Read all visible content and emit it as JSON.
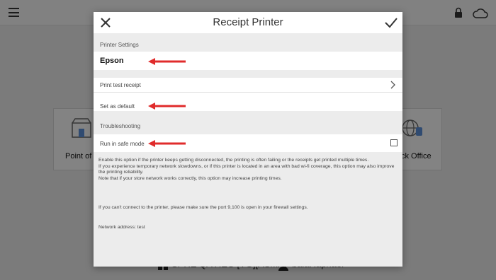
{
  "background": {
    "tiles": [
      {
        "label": "Point of S"
      },
      {
        "label": "ck Office"
      }
    ],
    "footer": {
      "store": "SPRE QA REG [YG][ASMA]",
      "user": "baiaRaphael"
    }
  },
  "dialog": {
    "title": "Receipt Printer",
    "close_icon": "close-icon",
    "confirm_icon": "checkmark-icon",
    "printer_settings": {
      "header": "Printer Settings",
      "printer_name": "Epson",
      "print_test_label": "Print test receipt",
      "set_default_label": "Set as default"
    },
    "troubleshooting": {
      "header": "Troubleshooting",
      "safe_mode_label": "Run in safe mode",
      "safe_mode_checked": false,
      "description": {
        "line1": "Enable this option if the printer keeps getting disconnected, the printing is often failing or the receipts get printed multiple times.",
        "line2": "If you experience temporary network slowdowns, or if this printer is located in an area with bad wi-fi coverage, this option may also improve the printing reliability.",
        "line3": "Note that if your store network works correctly, this option may increase printing times.",
        "port_note": "If you can't connect to the printer, please make sure the port 9,100 is open in your firewall settings.",
        "network_address": "Network address: test"
      }
    }
  },
  "colors": {
    "annotation_red": "#e02b2b",
    "overlay": "#000000"
  }
}
